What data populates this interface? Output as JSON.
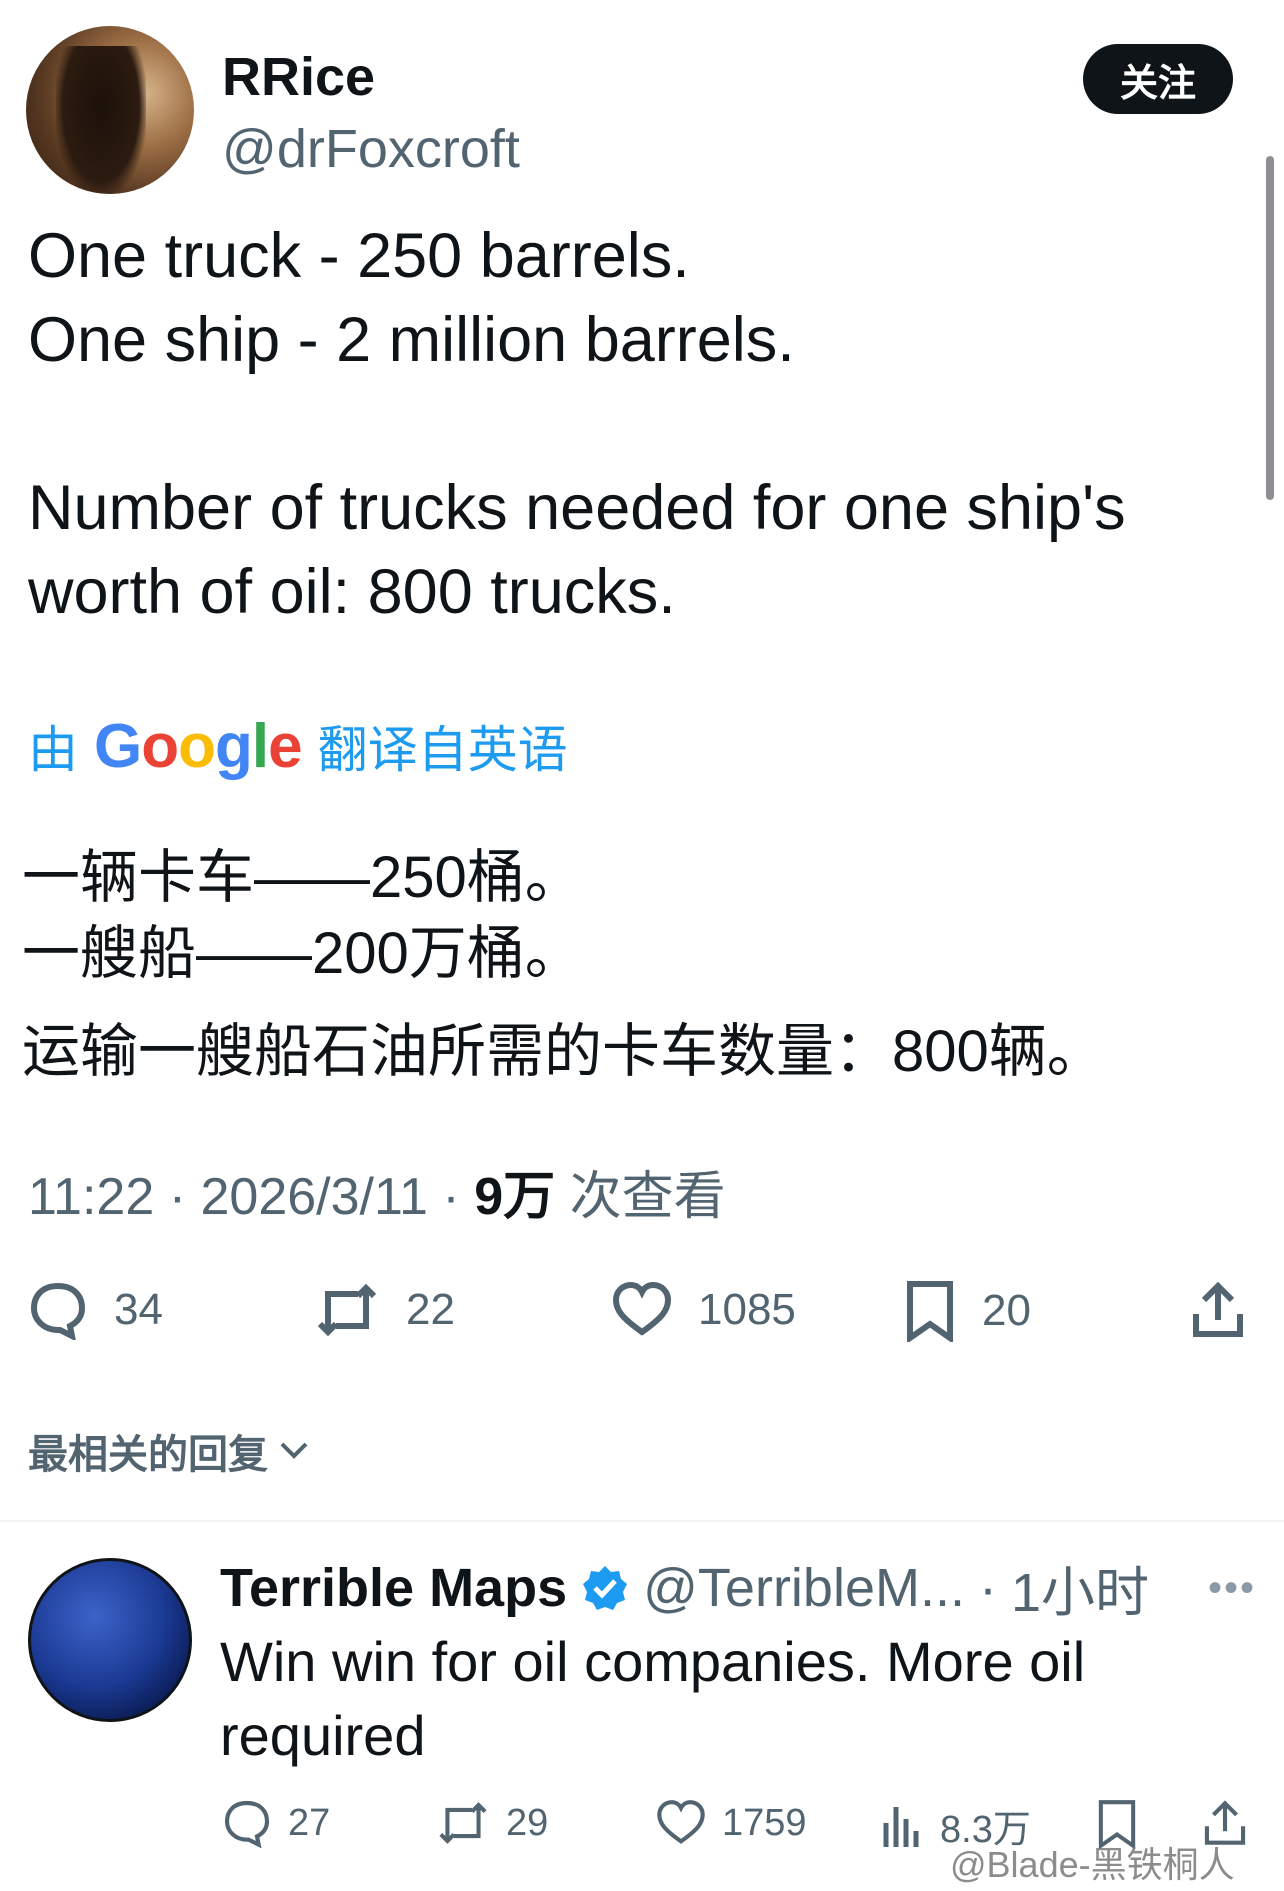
{
  "tweet": {
    "author_name": "RRice",
    "author_handle": "@drFoxcroft",
    "follow_label": "关注",
    "lines": [
      "One truck - 250 barrels.",
      "One ship - 2 million barrels.",
      "Number of trucks needed for one ship's",
      "worth of oil: 800 trucks."
    ],
    "translate_prefix": "由",
    "translate_brand": "Google",
    "translate_suffix": "翻译自英语",
    "translation_lines": [
      "一辆卡车——250桶。",
      "一艘船——200万桶。",
      "运输一艘船石油所需的卡车数量：800辆。"
    ],
    "time": "11:22",
    "date": "2026/3/11",
    "views_count": "9万",
    "views_label": "次查看",
    "stats": {
      "replies": "34",
      "reposts": "22",
      "likes": "1085",
      "bookmarks": "20"
    }
  },
  "replies_sort_label": "最相关的回复",
  "reply": {
    "author_name": "Terrible Maps",
    "author_handle": "@TerribleM...",
    "time": "1小时",
    "more": "•••",
    "lines": [
      "Win win for oil companies. More oil",
      "required"
    ],
    "stats": {
      "replies": "27",
      "reposts": "29",
      "likes": "1759",
      "views": "8.3万"
    }
  },
  "watermark": "@Blade-黑铁桐人",
  "colors": {
    "accent": "#1d9bf0",
    "text": "#0f1419",
    "secondary": "#536471",
    "google_blue": "#4285F4",
    "google_red": "#EA4335",
    "google_yellow": "#FBBC05",
    "google_green": "#34A853"
  }
}
